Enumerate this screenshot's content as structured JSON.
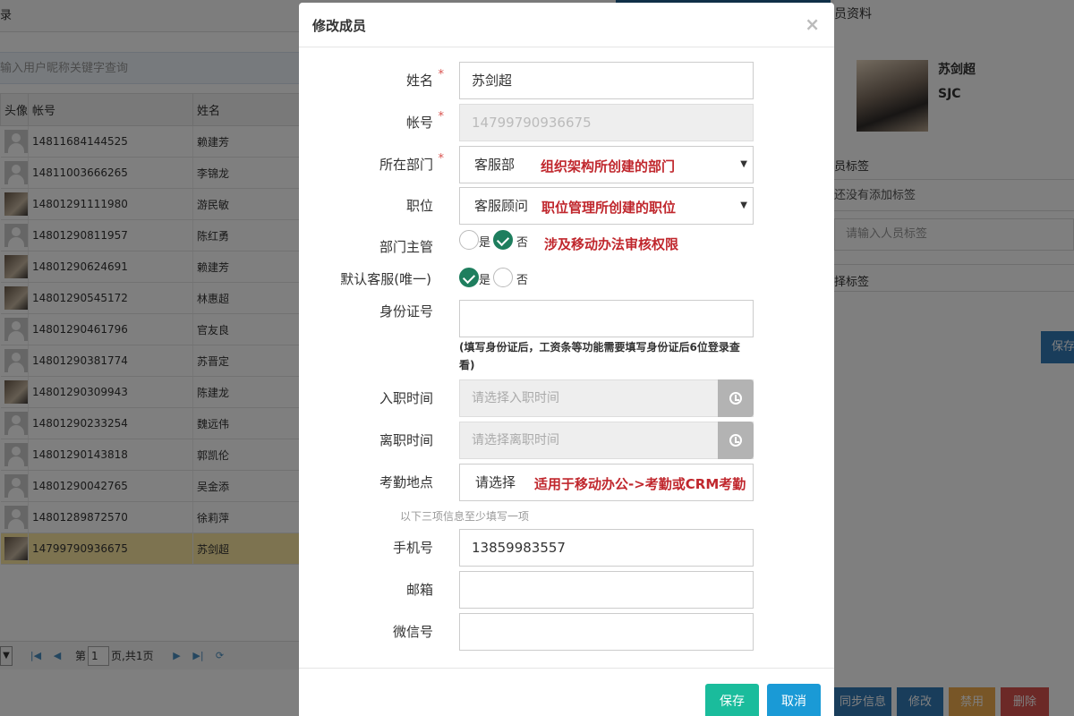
{
  "background": {
    "left_title": "录",
    "search_placeholder": "输入用户昵称关键字查询",
    "columns": [
      "头像",
      "帐号",
      "姓名"
    ],
    "rows": [
      {
        "account": "14811684144525",
        "name": "赖建芳",
        "photo": false
      },
      {
        "account": "14811003666265",
        "name": "李锦龙",
        "photo": false
      },
      {
        "account": "14801291111980",
        "name": "游民敏",
        "photo": true
      },
      {
        "account": "14801290811957",
        "name": "陈红勇",
        "photo": false
      },
      {
        "account": "14801290624691",
        "name": "赖建芳",
        "photo": true
      },
      {
        "account": "14801290545172",
        "name": "林惠超",
        "photo": true
      },
      {
        "account": "14801290461796",
        "name": "官友良",
        "photo": false
      },
      {
        "account": "14801290381774",
        "name": "苏晋定",
        "photo": false
      },
      {
        "account": "14801290309943",
        "name": "陈建龙",
        "photo": true
      },
      {
        "account": "14801290233254",
        "name": "魏远伟",
        "photo": false
      },
      {
        "account": "14801290143818",
        "name": "郭凯伦",
        "photo": false
      },
      {
        "account": "14801290042765",
        "name": "吴金添",
        "photo": false
      },
      {
        "account": "14801289872570",
        "name": "徐莉萍",
        "photo": false
      },
      {
        "account": "14799790936675",
        "name": "苏剑超",
        "photo": true,
        "selected": true
      }
    ],
    "pager": {
      "page_prefix": "第",
      "page_value": "1",
      "page_suffix": "页,共1页"
    },
    "right": {
      "title": "员资料",
      "name": "苏剑超",
      "code": "SJC",
      "section1": "员标签",
      "empty_text": "还没有添加标签",
      "tag_placeholder": "请输入人员标签",
      "section2": "择标签",
      "save": "保存",
      "buttons": [
        {
          "label": "同步信息",
          "color": "#337ab7"
        },
        {
          "label": "修改",
          "color": "#337ab7"
        },
        {
          "label": "禁用",
          "color": "#f0ad4e"
        },
        {
          "label": "删除",
          "color": "#d9534f"
        }
      ]
    }
  },
  "modal": {
    "title": "修改成员",
    "close": "×",
    "fields": {
      "name": {
        "label": "姓名",
        "value": "苏剑超",
        "required": true
      },
      "account": {
        "label": "帐号",
        "value": "14799790936675",
        "required": true
      },
      "dept": {
        "label": "所在部门",
        "value": "客服部",
        "required": true,
        "note": "组织架构所创建的部门"
      },
      "position": {
        "label": "职位",
        "value": "客服顾问",
        "note": "职位管理所创建的职位"
      },
      "manager": {
        "label": "部门主管",
        "yes": "是",
        "no": "否",
        "selected": "no",
        "note": "涉及移动办法审核权限"
      },
      "default_service": {
        "label": "默认客服(唯一)",
        "yes": "是",
        "no": "否",
        "selected": "yes"
      },
      "id_card": {
        "label": "身份证号",
        "value": "",
        "hint": "(填写身份证后，工资条等功能需要填写身份证后6位登录查看)"
      },
      "join_date": {
        "label": "入职时间",
        "placeholder": "请选择入职时间"
      },
      "leave_date": {
        "label": "离职时间",
        "placeholder": "请选择离职时间"
      },
      "attendance": {
        "label": "考勤地点",
        "value": "请选择",
        "note": "适用于移动办公->考勤或CRM考勤"
      },
      "sub_note": "以下三项信息至少填写一项",
      "phone": {
        "label": "手机号",
        "value": "13859983557"
      },
      "email": {
        "label": "邮箱",
        "value": ""
      },
      "wechat": {
        "label": "微信号",
        "value": ""
      }
    },
    "buttons": {
      "save": "保存",
      "cancel": "取消"
    },
    "colors": {
      "save": "#1abc9c",
      "cancel": "#1a9ad6",
      "accent_note": "#c0272d"
    }
  }
}
